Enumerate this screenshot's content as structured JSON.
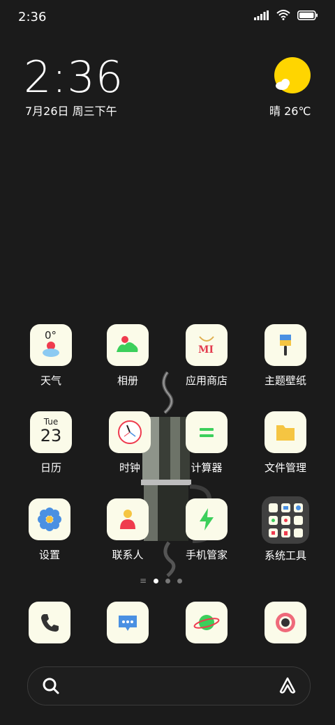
{
  "status_bar": {
    "time": "2:36"
  },
  "lock_widget": {
    "clock": "2:36",
    "date": "7月26日 周三下午",
    "weather": "晴 26℃"
  },
  "apps": [
    {
      "label": "天气",
      "icon": "weather-icon",
      "value": "0°"
    },
    {
      "label": "相册",
      "icon": "gallery-icon"
    },
    {
      "label": "应用商店",
      "icon": "app-store-icon",
      "value": "MI"
    },
    {
      "label": "主题壁纸",
      "icon": "theme-brush-icon"
    },
    {
      "label": "日历",
      "icon": "calendar-icon",
      "day": "Tue",
      "date": "23"
    },
    {
      "label": "时钟",
      "icon": "clock-icon"
    },
    {
      "label": "计算器",
      "icon": "calculator-icon"
    },
    {
      "label": "文件管理",
      "icon": "folder-icon"
    },
    {
      "label": "设置",
      "icon": "settings-icon"
    },
    {
      "label": "联系人",
      "icon": "contacts-icon"
    },
    {
      "label": "手机管家",
      "icon": "security-icon"
    },
    {
      "label": "系统工具",
      "icon": "folder-group-icon"
    }
  ],
  "dock": [
    {
      "icon": "phone-icon"
    },
    {
      "icon": "messages-icon"
    },
    {
      "icon": "browser-icon"
    },
    {
      "icon": "camera-icon"
    }
  ],
  "colors": {
    "tile_bg": "#fbfbe9",
    "background": "#1b1b1b",
    "accent_green": "#3ccf5b"
  }
}
